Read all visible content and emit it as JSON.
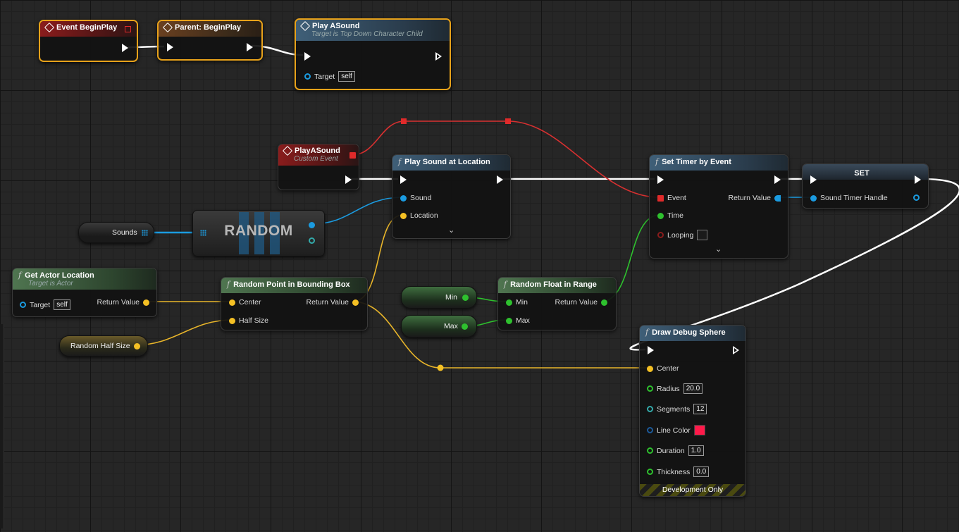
{
  "colors": {
    "exec": "#ffffff",
    "object": "#1b9be0",
    "vector": "#f4c024",
    "float": "#2ec12e",
    "delegate": "#e02a2a",
    "selection": "#e8a21a",
    "line_color_value": "#ff1a4a"
  },
  "event_beginplay": {
    "title": "Event BeginPlay",
    "icon": "event-diamond-icon"
  },
  "parent_beginplay": {
    "title": "Parent: BeginPlay",
    "icon": "event-diamond-icon"
  },
  "play_a_sound_call": {
    "title": "Play ASound",
    "subtitle": "Target is Top Down Character Child",
    "target_label": "Target",
    "target_value": "self"
  },
  "custom_event": {
    "title": "PlayASound",
    "subtitle": "Custom Event"
  },
  "play_sound_at_location": {
    "title": "Play Sound at Location",
    "sound_label": "Sound",
    "location_label": "Location",
    "icon": "function-icon"
  },
  "set_timer": {
    "title": "Set Timer by Event",
    "event_label": "Event",
    "return_label": "Return Value",
    "time_label": "Time",
    "looping_label": "Looping"
  },
  "set_var": {
    "title": "SET",
    "pin_label": "Sound Timer Handle"
  },
  "sounds_var": {
    "label": "Sounds"
  },
  "random_node": {
    "label": "RANDOM"
  },
  "get_actor_location": {
    "title": "Get Actor Location",
    "subtitle": "Target is Actor",
    "target_label": "Target",
    "target_value": "self",
    "return_label": "Return Value"
  },
  "random_point": {
    "title": "Random Point in Bounding Box",
    "center_label": "Center",
    "half_size_label": "Half Size",
    "return_label": "Return Value"
  },
  "random_half_size_var": {
    "label": "Random Half Size"
  },
  "min_var": {
    "label": "Min"
  },
  "max_var": {
    "label": "Max"
  },
  "random_float": {
    "title": "Random Float in Range",
    "min_label": "Min",
    "max_label": "Max",
    "return_label": "Return Value"
  },
  "draw_debug_sphere": {
    "title": "Draw Debug Sphere",
    "center_label": "Center",
    "radius_label": "Radius",
    "radius_value": "20.0",
    "segments_label": "Segments",
    "segments_value": "12",
    "line_color_label": "Line Color",
    "duration_label": "Duration",
    "duration_value": "1.0",
    "thickness_label": "Thickness",
    "thickness_value": "0.0",
    "footer": "Development Only"
  }
}
